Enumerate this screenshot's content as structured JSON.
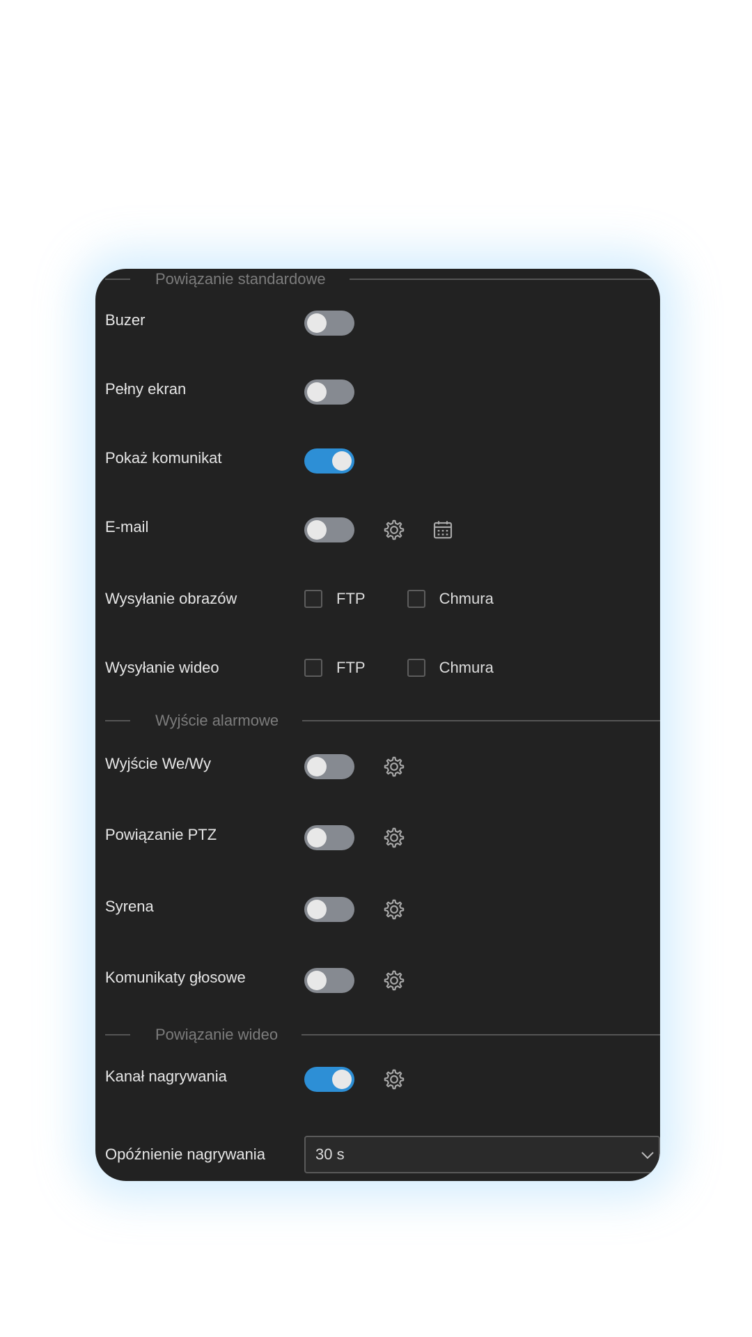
{
  "sections": {
    "standard": "Powiązanie standardowe",
    "alarm": "Wyjście alarmowe",
    "video": "Powiązanie wideo"
  },
  "rows": {
    "buzzer": {
      "label": "Buzer",
      "on": false
    },
    "fullscreen": {
      "label": "Pełny ekran",
      "on": false
    },
    "show_message": {
      "label": "Pokaż komunikat",
      "on": true
    },
    "email": {
      "label": "E-mail",
      "on": false
    },
    "image_upload": {
      "label": "Wysyłanie obrazów",
      "ftp_label": "FTP",
      "cloud_label": "Chmura",
      "ftp_checked": false,
      "cloud_checked": false
    },
    "video_upload": {
      "label": "Wysyłanie wideo",
      "ftp_label": "FTP",
      "cloud_label": "Chmura",
      "ftp_checked": false,
      "cloud_checked": false
    },
    "io_output": {
      "label": "Wyjście We/Wy",
      "on": false
    },
    "ptz_link": {
      "label": "Powiązanie PTZ",
      "on": false
    },
    "siren": {
      "label": "Syrena",
      "on": false
    },
    "voice_messages": {
      "label": "Komunikaty głosowe",
      "on": false
    },
    "record_channel": {
      "label": "Kanał nagrywania",
      "on": true
    },
    "record_delay": {
      "label": "Opóźnienie nagrywania",
      "value": "30 s"
    }
  },
  "icons": {
    "settings": "gear-icon",
    "schedule": "calendar-icon",
    "dropdown": "chevron-down-icon"
  },
  "colors": {
    "panel_bg": "#222222",
    "toggle_on": "#2d8fd6",
    "toggle_off": "#868a91",
    "section_title": "#7c7c7c"
  }
}
